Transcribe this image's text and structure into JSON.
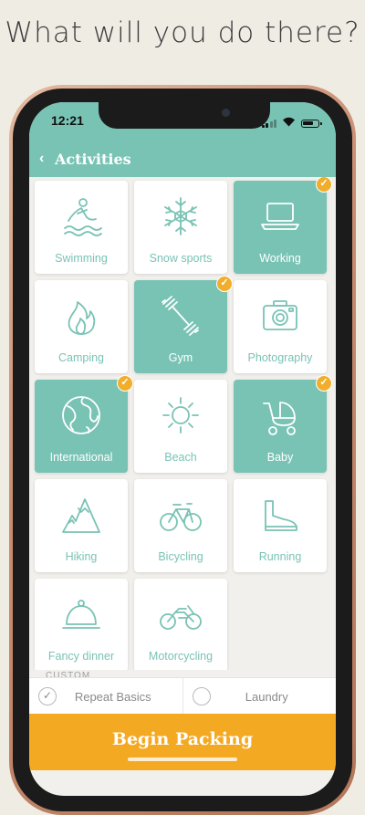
{
  "headline": "What will you do there?",
  "status": {
    "time": "12:21"
  },
  "nav": {
    "title": "Activities",
    "back_icon": "chevron-left-icon"
  },
  "colors": {
    "teal": "#79c3b5",
    "orange": "#f4a923",
    "check": "#f1ae2c"
  },
  "activities": [
    {
      "label": "Swimming",
      "icon": "swimmer-icon",
      "selected": false
    },
    {
      "label": "Snow sports",
      "icon": "snowflake-icon",
      "selected": false
    },
    {
      "label": "Working",
      "icon": "laptop-icon",
      "selected": true
    },
    {
      "label": "Camping",
      "icon": "fire-icon",
      "selected": false
    },
    {
      "label": "Gym",
      "icon": "dumbbell-icon",
      "selected": true
    },
    {
      "label": "Photography",
      "icon": "camera-icon",
      "selected": false
    },
    {
      "label": "International",
      "icon": "globe-icon",
      "selected": true
    },
    {
      "label": "Beach",
      "icon": "sun-icon",
      "selected": false
    },
    {
      "label": "Baby",
      "icon": "stroller-icon",
      "selected": true
    },
    {
      "label": "Hiking",
      "icon": "mountain-icon",
      "selected": false
    },
    {
      "label": "Bicycling",
      "icon": "bicycle-icon",
      "selected": false
    },
    {
      "label": "Running",
      "icon": "shoe-icon",
      "selected": false
    },
    {
      "label": "Fancy dinner",
      "icon": "cloche-icon",
      "selected": false
    },
    {
      "label": "Motorcycling",
      "icon": "motorcycle-icon",
      "selected": false
    }
  ],
  "custom": {
    "label": "CUSTOM",
    "items": [
      {
        "label": "Repeat Basics",
        "checked": true
      },
      {
        "label": "Laundry",
        "checked": false
      }
    ]
  },
  "begin_label": "Begin Packing"
}
